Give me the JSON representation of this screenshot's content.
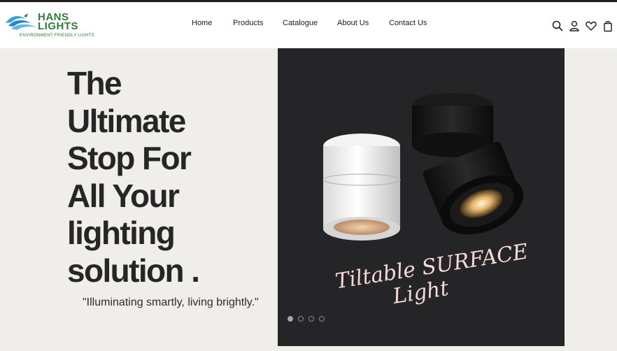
{
  "brand": {
    "name_line1": "HANS",
    "name_line2": "LIGHTS",
    "tagline": "ENVIRONMENT FRIENDLY LIGHTS",
    "accent": "#2e7d3a",
    "logo_icon": "swirl-logo-icon"
  },
  "nav": {
    "items": [
      {
        "label": "Home"
      },
      {
        "label": "Products"
      },
      {
        "label": "Catalogue"
      },
      {
        "label": "About Us"
      },
      {
        "label": "Contact Us"
      }
    ]
  },
  "header_icons": [
    "search-icon",
    "user-icon",
    "heart-icon",
    "bag-icon"
  ],
  "hero": {
    "headline_lines": [
      "The",
      "Ultimate",
      "Stop For",
      "All Your",
      "lighting",
      "solution ."
    ],
    "tagline": "\"Illuminating smartly, living brightly.\"",
    "slide": {
      "caption_line1": "Tiltable SURFACE",
      "caption_line2": "Light",
      "background": "#252528"
    },
    "carousel": {
      "total": 4,
      "active_index": 0
    }
  }
}
